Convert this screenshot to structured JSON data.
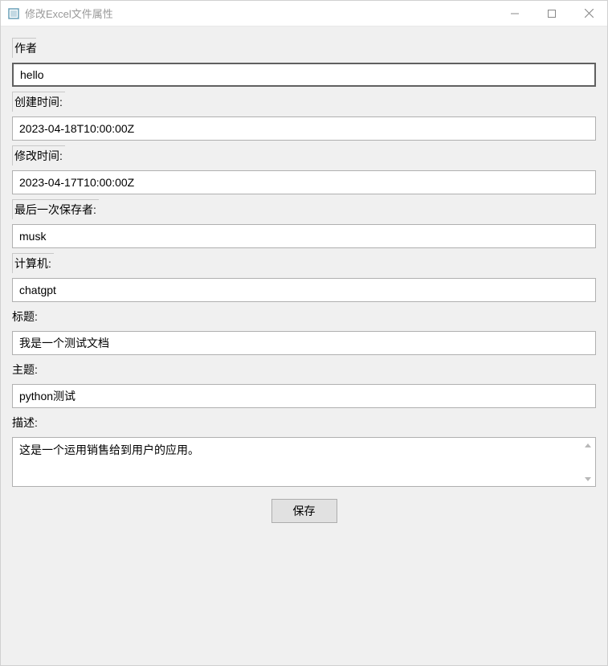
{
  "window": {
    "title": "修改Excel文件属性"
  },
  "fields": {
    "author": {
      "label": "作者:",
      "value": "hello"
    },
    "created": {
      "label": "创建时间:",
      "value": "2023-04-18T10:00:00Z"
    },
    "modified": {
      "label": "修改时间:",
      "value": "2023-04-17T10:00:00Z"
    },
    "lastSavedBy": {
      "label": "最后一次保存者:",
      "value": "musk"
    },
    "computer": {
      "label": "计算机:",
      "value": "chatgpt"
    },
    "title": {
      "label": "标题:",
      "value": "我是一个测试文档"
    },
    "subject": {
      "label": "主题:",
      "value": "python测试"
    },
    "description": {
      "label": "描述:",
      "value": "这是一个运用销售给到用户的应用。"
    }
  },
  "buttons": {
    "save": "保存"
  }
}
